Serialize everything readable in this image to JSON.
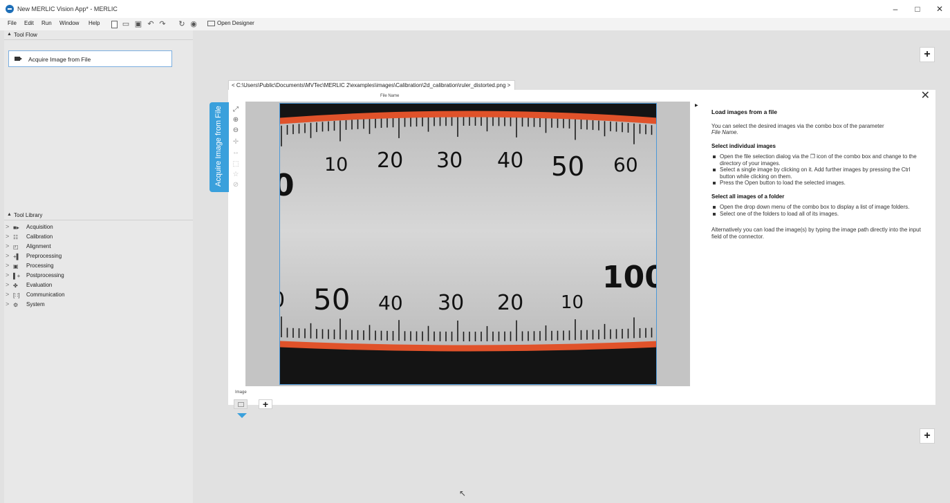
{
  "window": {
    "title": "New MERLIC Vision App* - MERLIC",
    "minimize": "–",
    "maximize": "□",
    "close": "✕"
  },
  "menu": {
    "items": [
      "File",
      "Edit",
      "Run",
      "Window",
      "Help"
    ],
    "open_designer": "Open Designer"
  },
  "tool_flow": {
    "header": "Tool Flow",
    "tools": [
      {
        "label": "Acquire Image from File",
        "icon": "camera-icon"
      }
    ]
  },
  "tool_library": {
    "header": "Tool Library",
    "items": [
      {
        "label": "Acquisition",
        "icon": "camera-icon"
      },
      {
        "label": "Calibration",
        "icon": "grid-icon"
      },
      {
        "label": "Alignment",
        "icon": "alignment-icon"
      },
      {
        "label": "Preprocessing",
        "icon": "preprocess-icon"
      },
      {
        "label": "Processing",
        "icon": "processing-icon"
      },
      {
        "label": "Postprocessing",
        "icon": "postprocess-icon"
      },
      {
        "label": "Evaluation",
        "icon": "evaluation-icon"
      },
      {
        "label": "Communication",
        "icon": "communication-icon"
      },
      {
        "label": "System",
        "icon": "system-icon"
      }
    ]
  },
  "tool_panel": {
    "side_tab": "Acquire Image from File",
    "file_path": "C:\\Users\\Public\\Documents\\MVTec\\MERLIC 2\\examples\\images\\Calibration\\2d_calibration\\ruler_distorted.png",
    "file_name_label": "File Name",
    "image_label": "Image",
    "add": "+",
    "close": "✕"
  },
  "ruler": {
    "top_numbers": [
      "10",
      "20",
      "30",
      "40",
      "50",
      "60"
    ],
    "top_partial": "0",
    "bottom_numbers": [
      "50",
      "40",
      "30",
      "20",
      "10"
    ],
    "bottom_big": "100",
    "bottom_partial": "0",
    "line_color": "#e0522a"
  },
  "help": {
    "title": "Load images from a file",
    "intro": "You can select the desired images via the combo box of the parameter",
    "intro_param": "File Name.",
    "section1_title": "Select individual images",
    "section1_items": [
      "Open the file selection dialog via the ❐ icon of the combo box and change to the directory of your images.",
      "Select a single image by clicking on it. Add further images by pressing the Ctrl button while clicking on them.",
      "Press the Open button to load the selected images."
    ],
    "section2_title": "Select all images of a folder",
    "section2_items": [
      "Open the drop down menu of the combo box to display a list of image folders.",
      "Select one of the folders to load all of its images."
    ],
    "outro": "Alternatively you can load the image(s) by typing the image path directly into the input field of the connector."
  },
  "colors": {
    "accent": "#3aa0dc",
    "selection_border": "#4b98d8"
  }
}
